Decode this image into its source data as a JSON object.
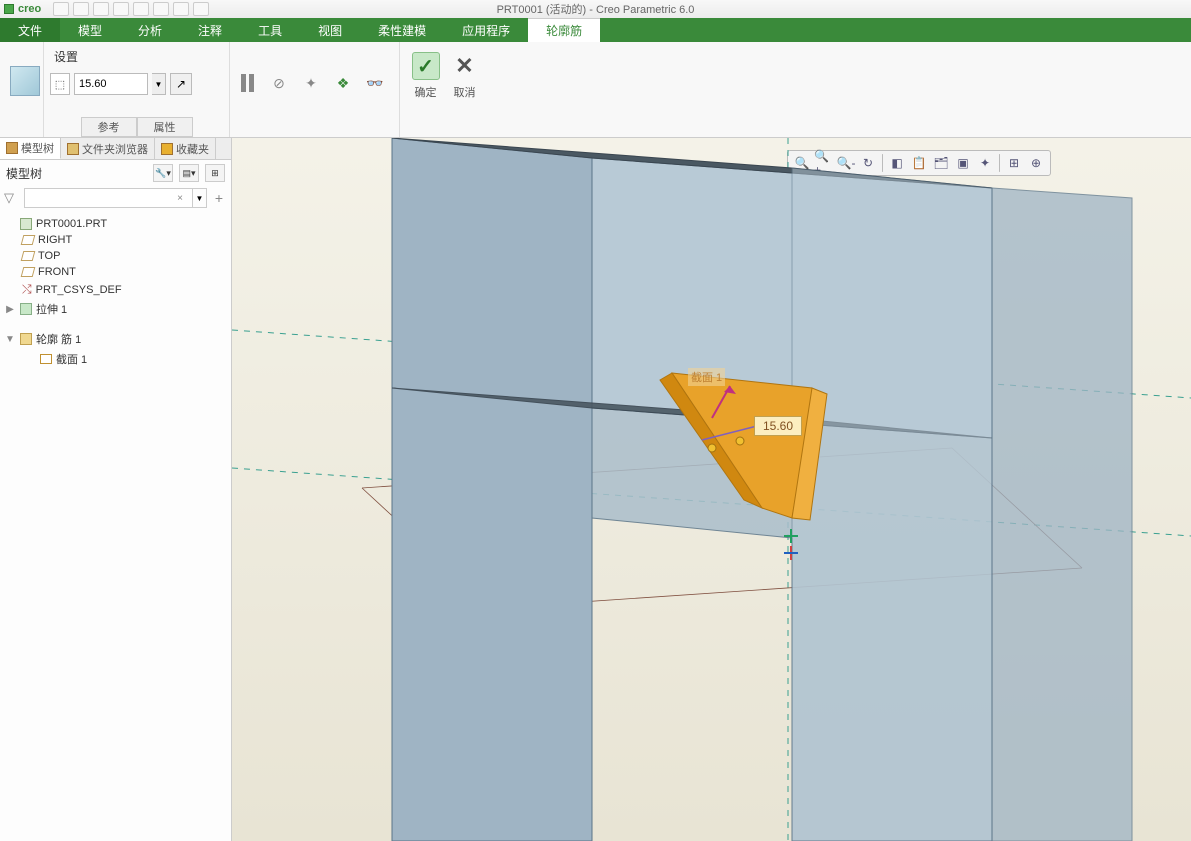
{
  "app": {
    "brand": "creo",
    "title": "PRT0001 (活动的) - Creo Parametric 6.0"
  },
  "menu": {
    "file": "文件",
    "items": [
      "模型",
      "分析",
      "注释",
      "工具",
      "视图",
      "柔性建模",
      "应用程序",
      "轮廓筋"
    ]
  },
  "ribbon": {
    "settings_label": "设置",
    "value": "15.60",
    "sub_tabs": {
      "ref": "参考",
      "attr": "属性"
    },
    "ok": "确定",
    "cancel": "取消"
  },
  "left_panel": {
    "tabs": {
      "model_tree": "模型树",
      "folder": "文件夹浏览器",
      "fav": "收藏夹"
    },
    "header": "模型树",
    "filter_placeholder": "",
    "tree": {
      "root": "PRT0001.PRT",
      "planes": [
        "RIGHT",
        "TOP",
        "FRONT"
      ],
      "csys": "PRT_CSYS_DEF",
      "extrude": "拉伸 1",
      "rib": "轮廓 筋 1",
      "section": "截面 1"
    }
  },
  "viewport": {
    "dimension": "15.60",
    "section_label": "截面 1"
  }
}
